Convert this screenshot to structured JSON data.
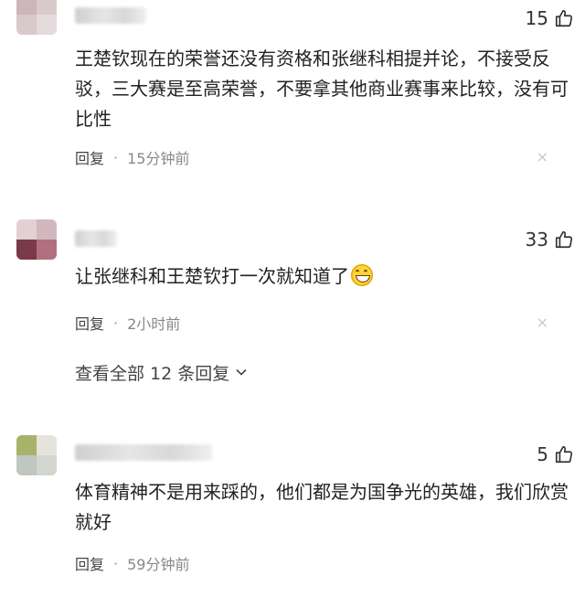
{
  "comments": [
    {
      "likes": "15",
      "content": "王楚钦现在的荣誉还没有资格和张继科相提并论，不接受反驳，三大赛是至高荣誉，不要拿其他商业赛事来比较，没有可比性",
      "reply_label": "回复",
      "dot": "·",
      "time": "15分钟前"
    },
    {
      "likes": "33",
      "content": "让张继科和王楚钦打一次就知道了",
      "reply_label": "回复",
      "dot": "·",
      "time": "2小时前",
      "view_all": "查看全部 12 条回复"
    },
    {
      "likes": "5",
      "content": "体育精神不是用来踩的，他们都是为国争光的英雄，我们欣赏就好",
      "reply_label": "回复",
      "dot": "·",
      "time": "59分钟前"
    }
  ],
  "icons": {
    "thumb": "thumbs-up-icon",
    "close": "close-icon",
    "chevron": "chevron-down-icon",
    "emoji": "grin-emoji-icon"
  },
  "close_glyph": "×"
}
